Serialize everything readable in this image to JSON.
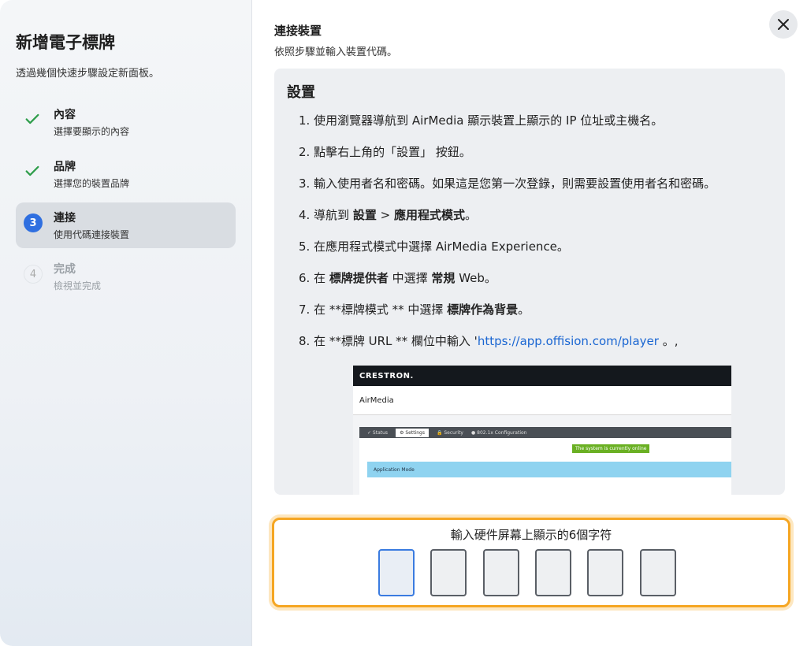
{
  "sidebar": {
    "title": "新增電子標牌",
    "subtitle": "透過幾個快速步驟設定新面板。",
    "steps": [
      {
        "indicator": "✓",
        "title": "內容",
        "desc": "選擇要顯示的內容",
        "state": "done"
      },
      {
        "indicator": "✓",
        "title": "品牌",
        "desc": "選擇您的裝置品牌",
        "state": "done"
      },
      {
        "indicator": "3",
        "title": "連接",
        "desc": "使用代碼連接裝置",
        "state": "active"
      },
      {
        "indicator": "4",
        "title": "完成",
        "desc": "檢視並完成",
        "state": "pending"
      }
    ]
  },
  "main": {
    "heading": "連接裝置",
    "subheading": "依照步驟並輸入裝置代碼。",
    "close_icon": "close-icon",
    "instructions": {
      "title": "設置",
      "steps": [
        {
          "prefix": "1. 使用瀏覽器導航到 AirMedia 顯示裝置上顯示的 IP 位址或主機名。"
        },
        {
          "prefix": "2. 點擊右上角的「設置」 按鈕。"
        },
        {
          "prefix": "3. 輸入使用者名和密碼。如果這是您第一次登錄，則需要設置使用者名和密碼。"
        },
        {
          "prefix": "4. 導航到 ",
          "bold1": "設置",
          "mid": " > ",
          "bold2": "應用程式模式",
          "suffix": "。"
        },
        {
          "prefix": "5. 在應用程式模式中選擇 AirMedia Experience。"
        },
        {
          "prefix": "6. 在 ",
          "bold1": "標牌提供者",
          "mid": " 中選擇 ",
          "bold2": "常規",
          "suffix": " Web。"
        },
        {
          "prefix": "7. 在 **標牌模式 ** 中選擇 ",
          "bold1": "標牌作為背景",
          "suffix": "。"
        },
        {
          "prefix": "8. 在 **標牌 URL ** 欄位中輸入 '",
          "link": "https://app.offision.com/player",
          "suffix": " 。,"
        }
      ],
      "screenshot": {
        "brand": "CRESTRON.",
        "app_name": "AirMedia",
        "tabs": [
          "✓ Status",
          "⚙ Settings",
          "🔒 Security",
          "● 802.1x Configuration"
        ],
        "online_badge": "The system is currently online",
        "section": "Application Mode"
      }
    },
    "code_entry": {
      "label": "輸入硬件屏幕上顯示的6個字符",
      "digits": [
        "",
        "",
        "",
        "",
        "",
        ""
      ]
    }
  },
  "colors": {
    "accent": "#2f6fe0",
    "check": "#2e9d4a",
    "highlight": "#f5a623",
    "link": "#1a66d2"
  }
}
